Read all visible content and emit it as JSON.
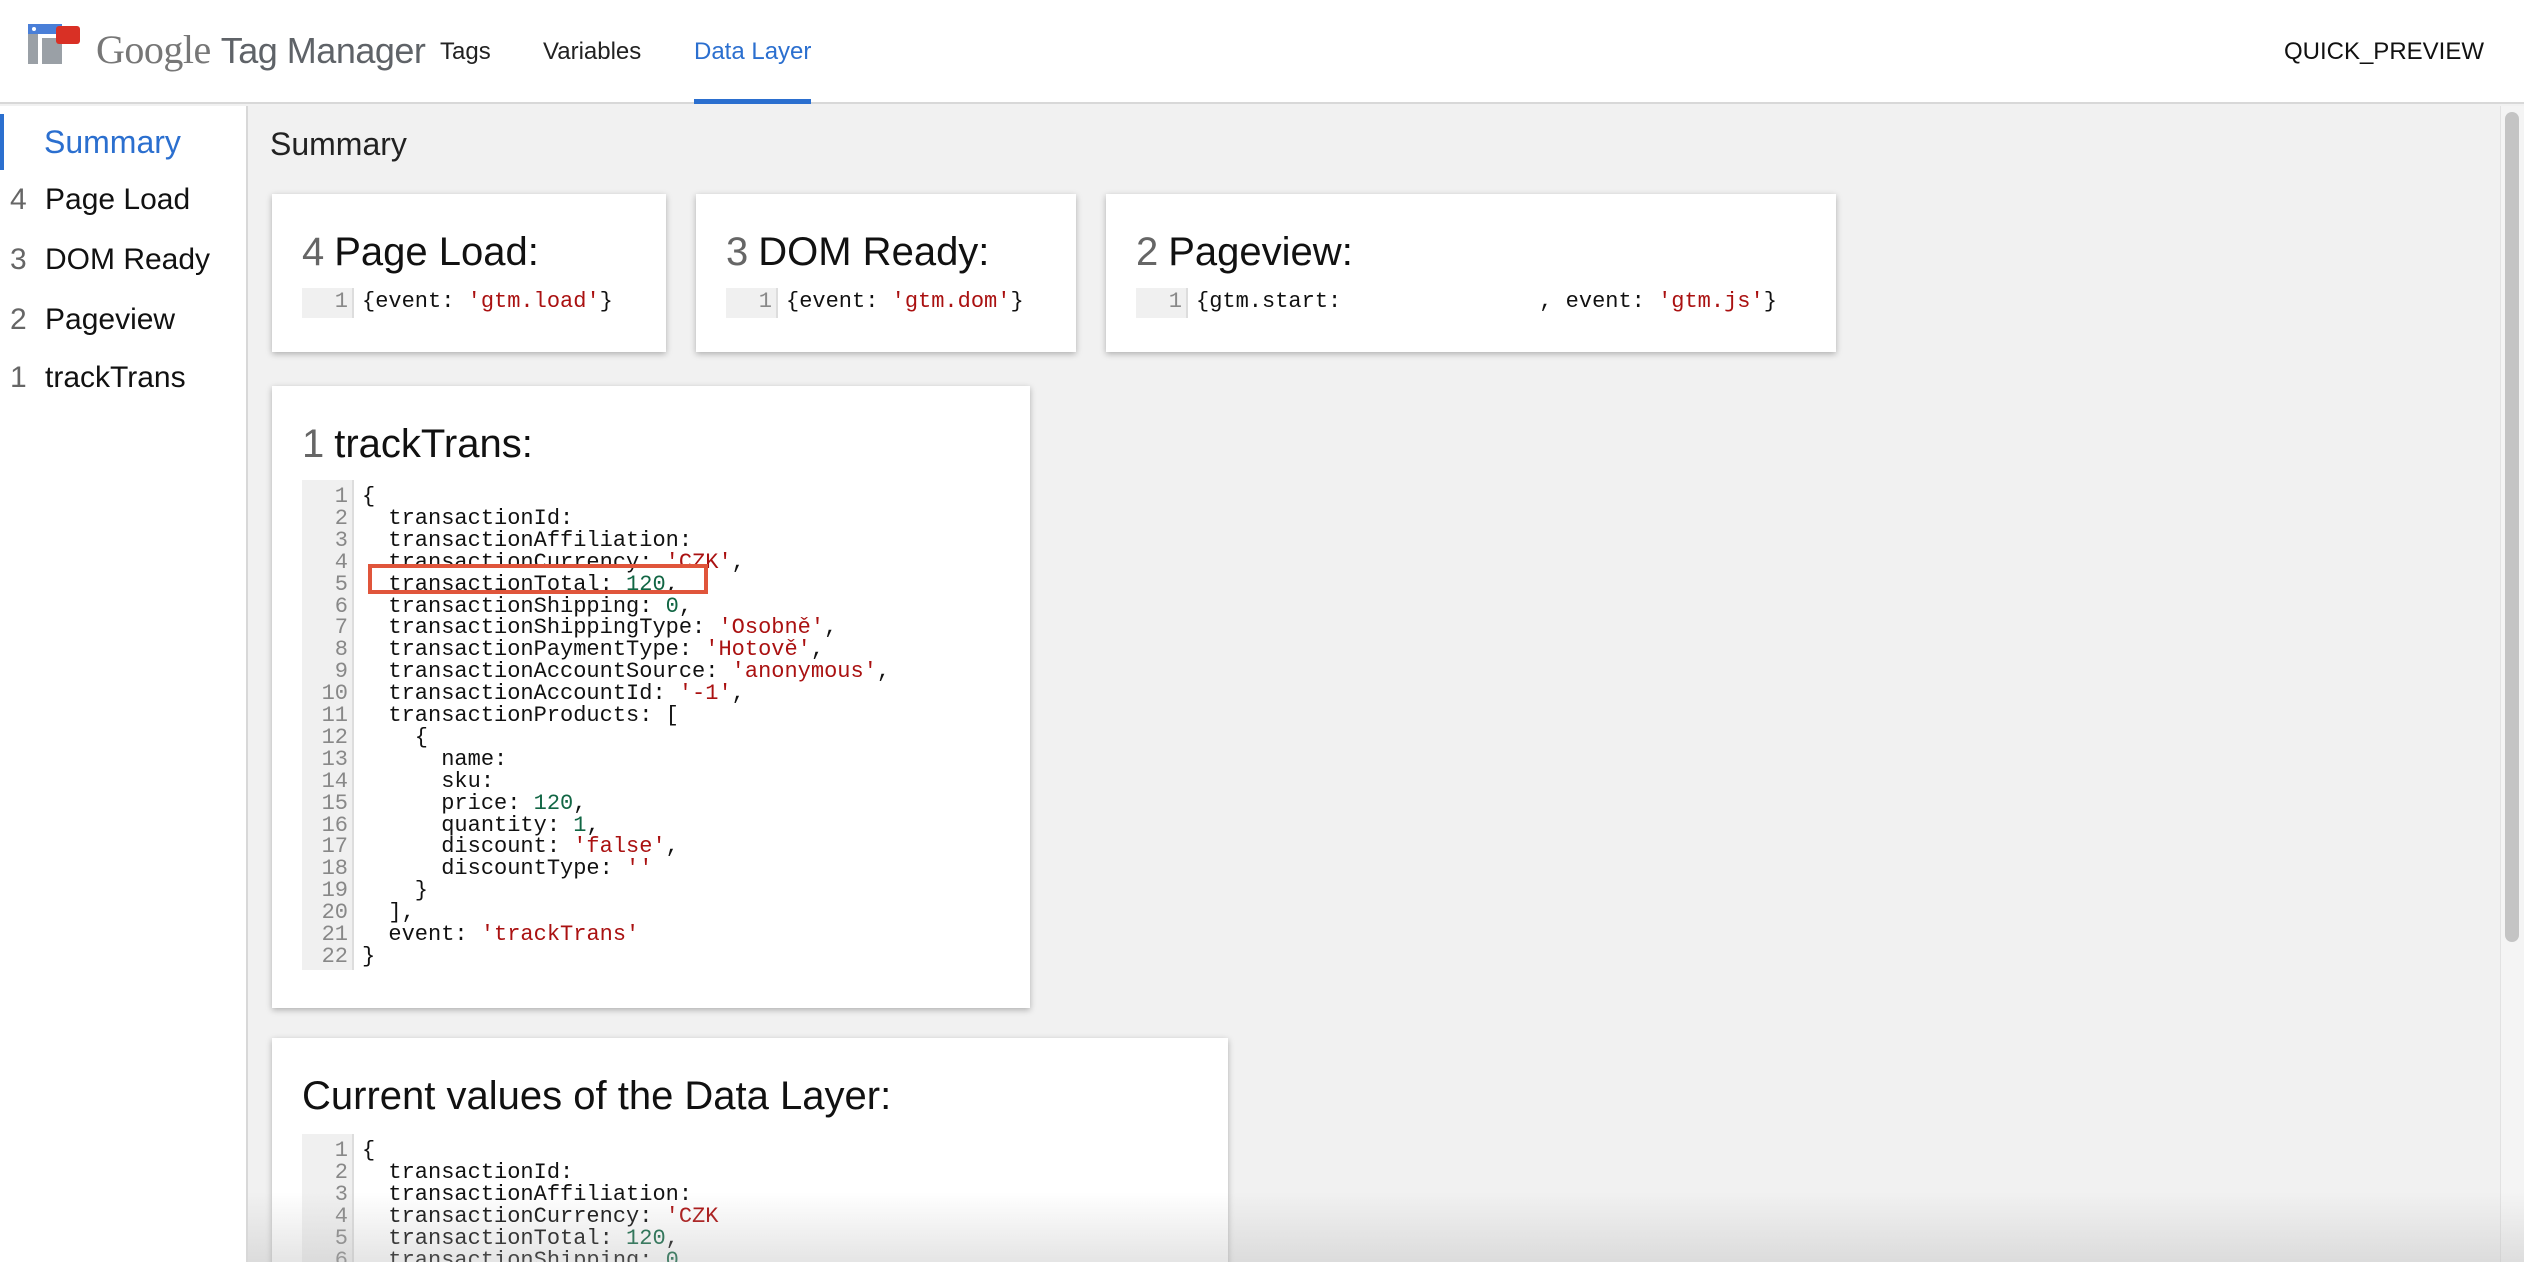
{
  "header": {
    "brand_google": "Google",
    "brand_product": "Tag Manager",
    "tabs": [
      {
        "label": "Tags"
      },
      {
        "label": "Variables"
      },
      {
        "label": "Data Layer"
      }
    ],
    "quick_preview": "QUICK_PREVIEW"
  },
  "sidebar": {
    "items": [
      {
        "num": "",
        "label": "Summary"
      },
      {
        "num": "4",
        "label": "Page Load"
      },
      {
        "num": "3",
        "label": "DOM Ready"
      },
      {
        "num": "2",
        "label": "Pageview"
      },
      {
        "num": "1",
        "label": "trackTrans"
      }
    ]
  },
  "main": {
    "title": "Summary",
    "cards": [
      {
        "num": "4",
        "title": "Page Load:",
        "line": "1",
        "code": "{event: ",
        "value": "'gtm.load'",
        "end": "}"
      },
      {
        "num": "3",
        "title": "DOM Ready:",
        "line": "1",
        "code": "{event: ",
        "value": "'gtm.dom'",
        "end": "}"
      },
      {
        "num": "2",
        "title": "Pageview:",
        "line": "1",
        "code": "{gtm.start:               , event: ",
        "value": "'gtm.js'",
        "end": "}"
      }
    ],
    "track": {
      "num": "1",
      "title": "trackTrans:",
      "lines": [
        "{",
        "  transactionId:",
        "  transactionAffiliation:",
        "  transactionCurrency: 'CZK',",
        "  transactionTotal: 120,",
        "  transactionShipping: 0,",
        "  transactionShippingType: 'Osobně',",
        "  transactionPaymentType: 'Hotově',",
        "  transactionAccountSource: 'anonymous',",
        "  transactionAccountId: '-1',",
        "  transactionProducts: [",
        "    {",
        "      name:",
        "      sku:",
        "      price: 120,",
        "      quantity: 1,",
        "      discount: 'false',",
        "      discountType: ''",
        "    }",
        "  ],",
        "  event: 'trackTrans'",
        "}"
      ]
    },
    "current": {
      "title": "Current values of the Data Layer:",
      "lines": [
        "{",
        "  transactionId:",
        "  transactionAffiliation:",
        "  transactionCurrency: 'CZK",
        "  transactionTotal: 120,",
        "  transactionShipping: 0"
      ]
    }
  }
}
